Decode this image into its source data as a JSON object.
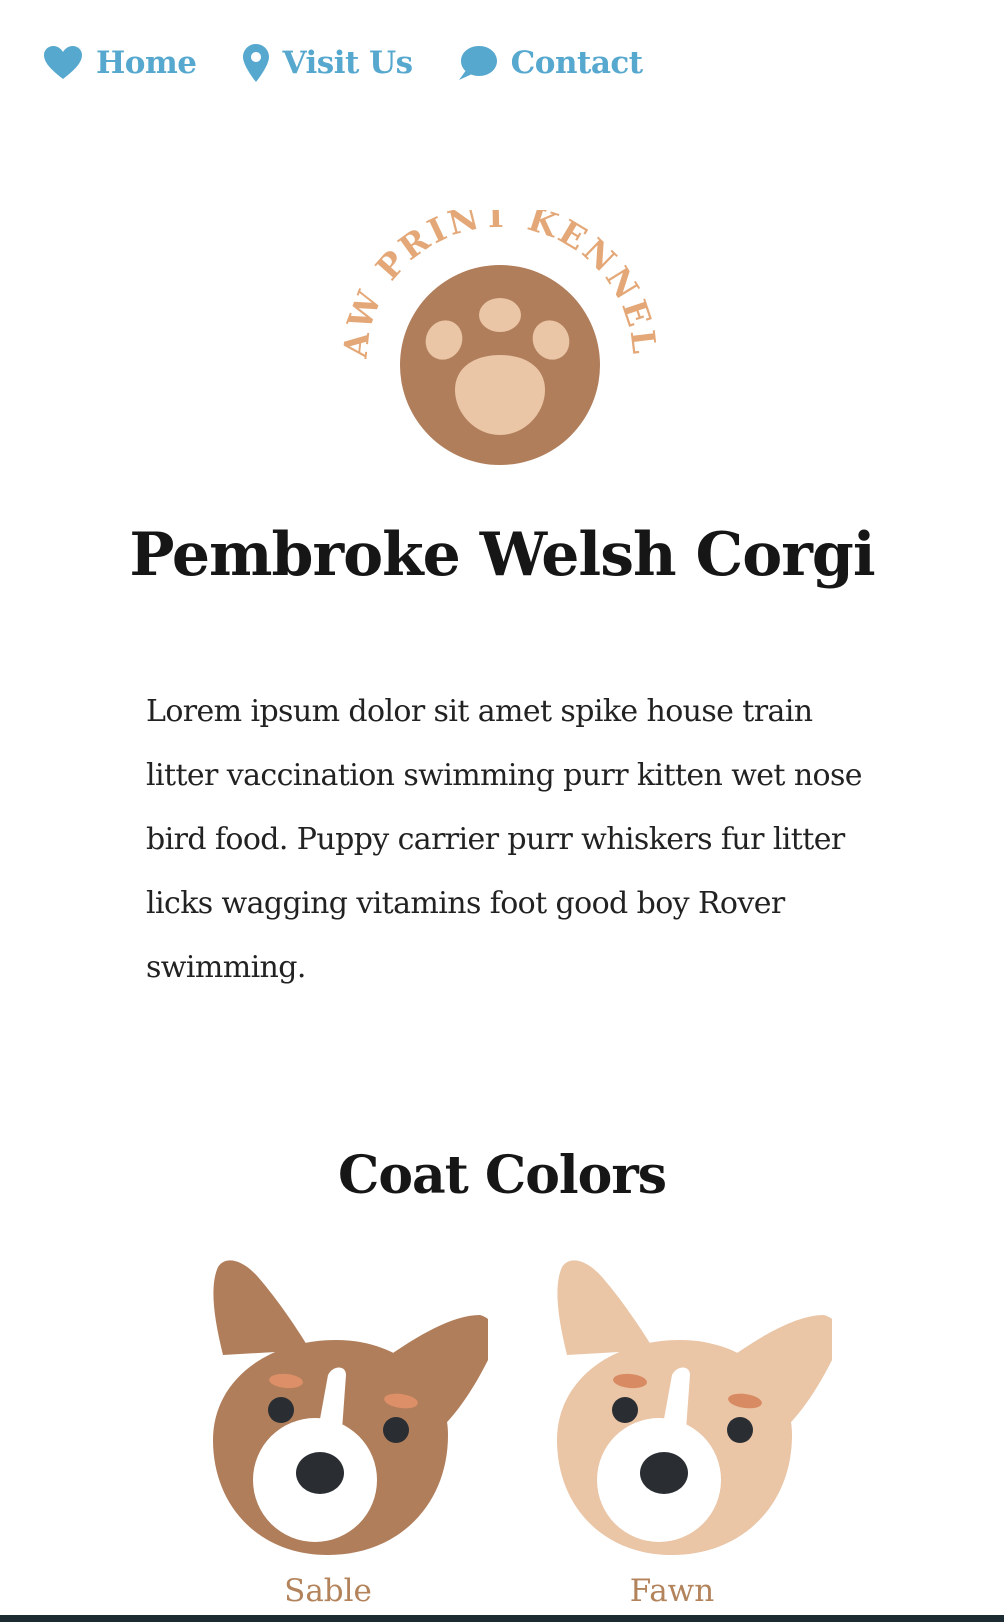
{
  "nav": {
    "items": [
      {
        "label": "Home",
        "icon": "heart-icon"
      },
      {
        "label": "Visit Us",
        "icon": "map-pin-icon"
      },
      {
        "label": "Contact",
        "icon": "chat-bubble-icon"
      }
    ],
    "color": "#56a8cf"
  },
  "logo": {
    "text": "PAW PRINT KENNELS",
    "icon": "paw-icon",
    "colors": {
      "circle": "#b07e5b",
      "paw": "#eac5a6",
      "text": "#e4a878"
    }
  },
  "page": {
    "title": "Pembroke Welsh Corgi",
    "intro": "Lorem ipsum dolor sit amet spike house train litter vaccination swimming purr kitten wet nose bird food. Puppy carrier purr whiskers fur litter licks wagging vitamins foot good boy Rover swimming."
  },
  "coats": {
    "title": "Coat Colors",
    "items": [
      {
        "label": "Sable",
        "icon": "corgi-face-icon",
        "color": "#b07e5b"
      },
      {
        "label": "Fawn",
        "icon": "corgi-face-icon",
        "color": "#eac5a6"
      }
    ]
  }
}
